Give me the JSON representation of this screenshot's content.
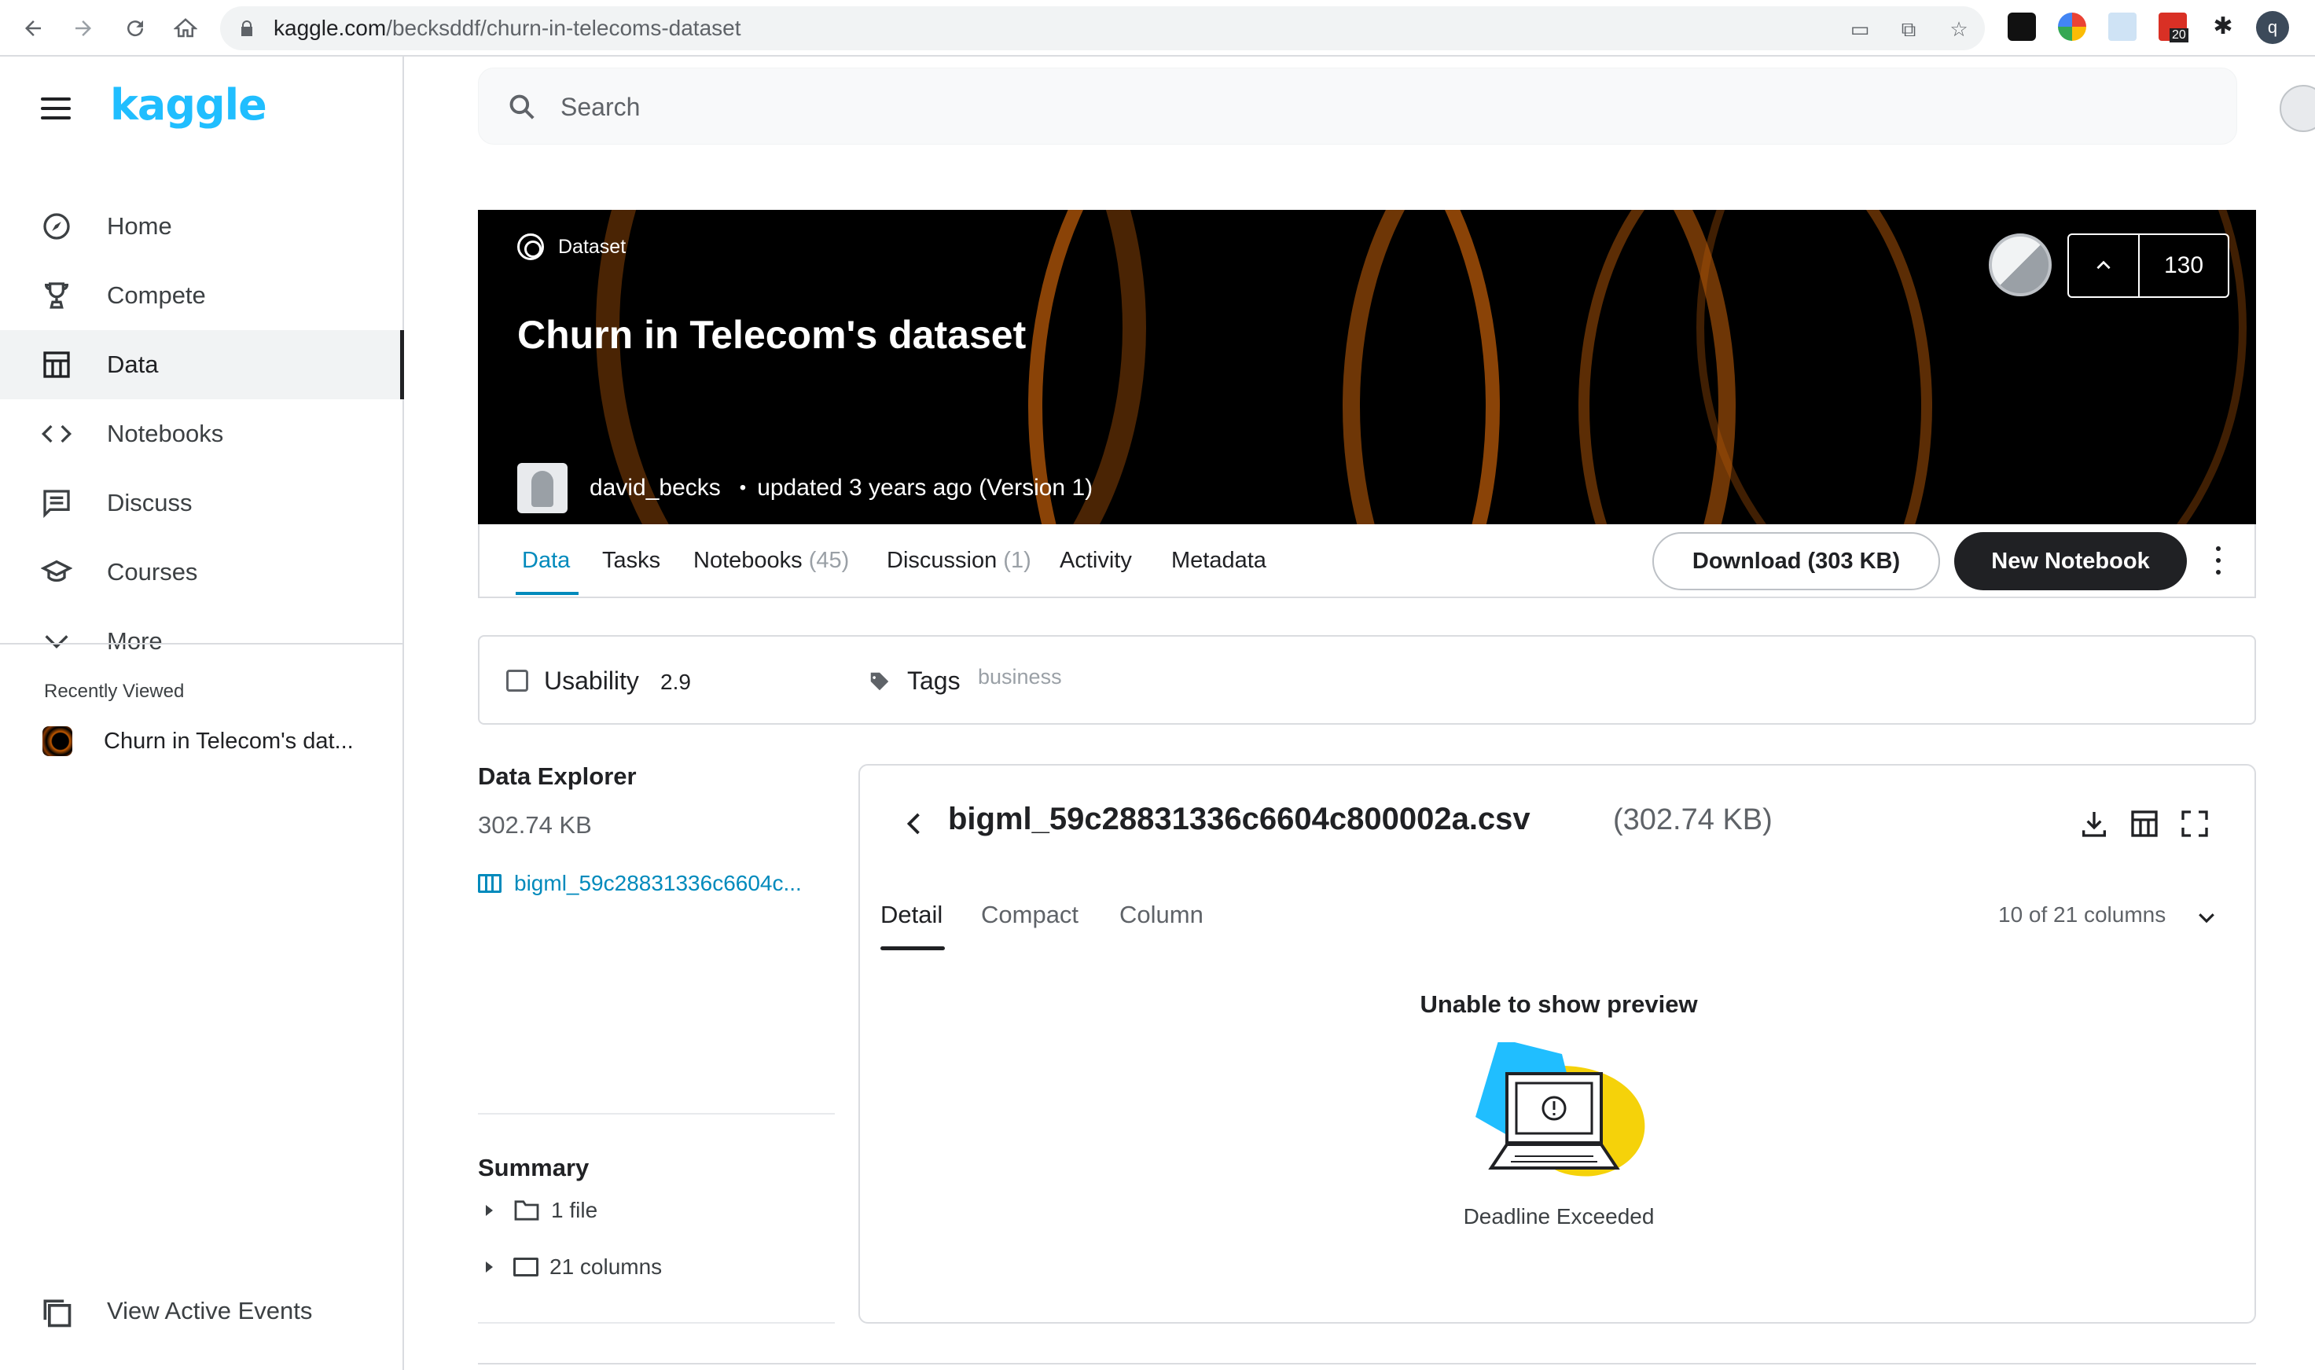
{
  "browser": {
    "url_host": "kaggle.com",
    "url_path": "/becksddf/churn-in-telecoms-dataset",
    "extension_badge": "20",
    "profile_initial": "q"
  },
  "sidebar": {
    "logo": "kaggle",
    "items": [
      {
        "label": "Home",
        "icon": "compass-icon"
      },
      {
        "label": "Compete",
        "icon": "trophy-icon"
      },
      {
        "label": "Data",
        "icon": "table-icon",
        "active": true
      },
      {
        "label": "Notebooks",
        "icon": "code-icon"
      },
      {
        "label": "Discuss",
        "icon": "comment-icon"
      },
      {
        "label": "Courses",
        "icon": "graduation-cap-icon"
      },
      {
        "label": "More",
        "icon": "chevron-down-icon"
      }
    ],
    "recent_heading": "Recently Viewed",
    "recent_item": "Churn in Telecom's dat...",
    "events_label": "View Active Events"
  },
  "search": {
    "placeholder": "Search"
  },
  "banner": {
    "type_label": "Dataset",
    "title": "Churn in Telecom's dataset",
    "author": "david_becks",
    "dot": "•",
    "updated": "updated 3 years ago (Version 1)",
    "upvotes": "130"
  },
  "tabs": {
    "data": "Data",
    "tasks": "Tasks",
    "notebooks": "Notebooks",
    "notebooks_count": "(45)",
    "discussion": "Discussion",
    "discussion_count": "(1)",
    "activity": "Activity",
    "metadata": "Metadata",
    "download": "Download (303 KB)",
    "new_notebook": "New Notebook"
  },
  "usability": {
    "label": "Usability",
    "value": "2.9",
    "tags_label": "Tags",
    "tag": "business"
  },
  "explorer": {
    "title": "Data Explorer",
    "size": "302.74 KB",
    "file": "bigml_59c28831336c6604c...",
    "summary_title": "Summary",
    "summary_files": "1 file",
    "summary_columns": "21 columns"
  },
  "preview": {
    "filename": "bigml_59c28831336c6604c800002a.csv",
    "filesize": "(302.74 KB)",
    "tab_detail": "Detail",
    "tab_compact": "Compact",
    "tab_column": "Column",
    "columns_selector": "10 of 21 columns",
    "message_title": "Unable to show preview",
    "message_detail": "Deadline Exceeded"
  }
}
